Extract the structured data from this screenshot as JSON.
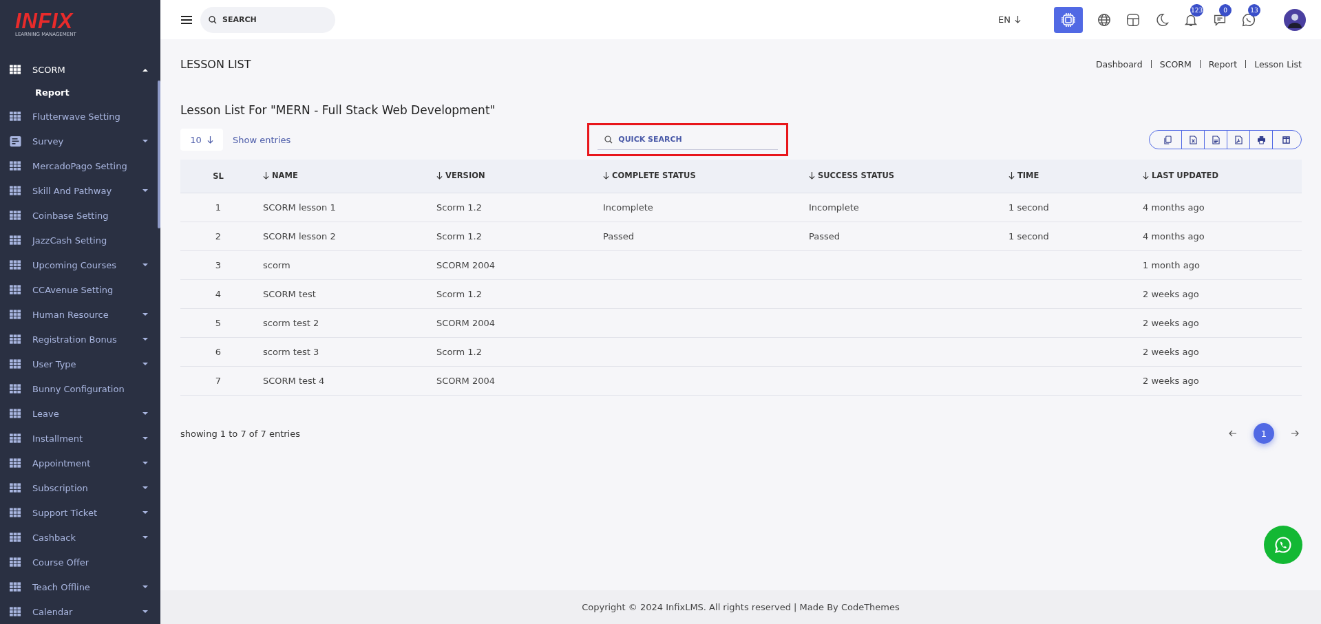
{
  "logo": {
    "brand": "INFIX",
    "tagline": "LEARNING MANAGEMENT"
  },
  "sidebar": {
    "items": [
      {
        "label": "SCORM",
        "kind": "grid",
        "expanded": true,
        "selected": true,
        "children": [
          {
            "label": "Report",
            "selected": true
          }
        ]
      },
      {
        "label": "Flutterwave Setting",
        "kind": "grid",
        "selected": false
      },
      {
        "label": "Survey",
        "kind": "doc",
        "expanded": false,
        "selected": false
      },
      {
        "label": "MercadoPago Setting",
        "kind": "grid",
        "selected": false
      },
      {
        "label": "Skill And Pathway",
        "kind": "grid",
        "expanded": false,
        "selected": false
      },
      {
        "label": "Coinbase Setting",
        "kind": "grid",
        "selected": false
      },
      {
        "label": "JazzCash Setting",
        "kind": "grid",
        "selected": false
      },
      {
        "label": "Upcoming Courses",
        "kind": "grid",
        "expanded": false,
        "selected": false
      },
      {
        "label": "CCAvenue Setting",
        "kind": "grid",
        "selected": false
      },
      {
        "label": "Human Resource",
        "kind": "grid",
        "expanded": false,
        "selected": false
      },
      {
        "label": "Registration Bonus",
        "kind": "grid",
        "expanded": false,
        "selected": false
      },
      {
        "label": "User Type",
        "kind": "grid",
        "expanded": false,
        "selected": false
      },
      {
        "label": "Bunny Configuration",
        "kind": "grid",
        "selected": false
      },
      {
        "label": "Leave",
        "kind": "grid",
        "expanded": false,
        "selected": false
      },
      {
        "label": "Installment",
        "kind": "grid",
        "expanded": false,
        "selected": false
      },
      {
        "label": "Appointment",
        "kind": "grid",
        "expanded": false,
        "selected": false
      },
      {
        "label": "Subscription",
        "kind": "grid",
        "expanded": false,
        "selected": false
      },
      {
        "label": "Support Ticket",
        "kind": "grid",
        "expanded": false,
        "selected": false
      },
      {
        "label": "Cashback",
        "kind": "grid",
        "expanded": false,
        "selected": false
      },
      {
        "label": "Course Offer",
        "kind": "grid",
        "selected": false
      },
      {
        "label": "Teach Offline",
        "kind": "grid",
        "expanded": false,
        "selected": false
      },
      {
        "label": "Calendar",
        "kind": "grid",
        "expanded": false,
        "selected": false
      }
    ]
  },
  "header": {
    "search": {
      "placeholder": "SEARCH"
    },
    "language": "EN",
    "badges": {
      "notifications": "123",
      "messages": "0",
      "chat": "13"
    }
  },
  "page": {
    "title": "LESSON LIST",
    "breadcrumb": [
      "Dashboard",
      "SCORM",
      "Report",
      "Lesson List"
    ]
  },
  "card": {
    "title": "Lesson List For \"MERN - Full Stack Web Development\"",
    "page_size": "10",
    "show_entries": "Show entries",
    "quick_search": {
      "placeholder": "QUICK SEARCH"
    },
    "export_buttons": [
      {
        "kind": "copy"
      },
      {
        "kind": "excel"
      },
      {
        "kind": "csv"
      },
      {
        "kind": "pdf"
      },
      {
        "kind": "print"
      },
      {
        "kind": "columns"
      }
    ]
  },
  "table": {
    "columns": [
      {
        "label": "SL",
        "sortable": false
      },
      {
        "label": "NAME",
        "sortable": true
      },
      {
        "label": "VERSION",
        "sortable": true
      },
      {
        "label": "COMPLETE STATUS",
        "sortable": true
      },
      {
        "label": "SUCCESS STATUS",
        "sortable": true
      },
      {
        "label": "TIME",
        "sortable": true
      },
      {
        "label": "LAST UPDATED",
        "sortable": true
      }
    ],
    "rows": [
      [
        "1",
        "SCORM lesson 1",
        "Scorm 1.2",
        "Incomplete",
        "Incomplete",
        "1 second",
        "4 months ago"
      ],
      [
        "2",
        "SCORM lesson 2",
        "Scorm 1.2",
        "Passed",
        "Passed",
        "1 second",
        "4 months ago"
      ],
      [
        "3",
        "scorm",
        "SCORM 2004",
        "",
        "",
        "",
        "1 month ago"
      ],
      [
        "4",
        "SCORM test",
        "Scorm 1.2",
        "",
        "",
        "",
        "2 weeks ago"
      ],
      [
        "5",
        "scorm test 2",
        "SCORM 2004",
        "",
        "",
        "",
        "2 weeks ago"
      ],
      [
        "6",
        "scorm test 3",
        "Scorm 1.2",
        "",
        "",
        "",
        "2 weeks ago"
      ],
      [
        "7",
        "SCORM test 4",
        "SCORM 2004",
        "",
        "",
        "",
        "2 weeks ago"
      ]
    ]
  },
  "pagination": {
    "summary": "showing 1 to 7 of 7 entries",
    "pages": [
      {
        "label": "1",
        "selected": true
      }
    ]
  },
  "footer": {
    "text": "Copyright © 2024 InfixLMS. All rights reserved | Made By CodeThemes"
  }
}
